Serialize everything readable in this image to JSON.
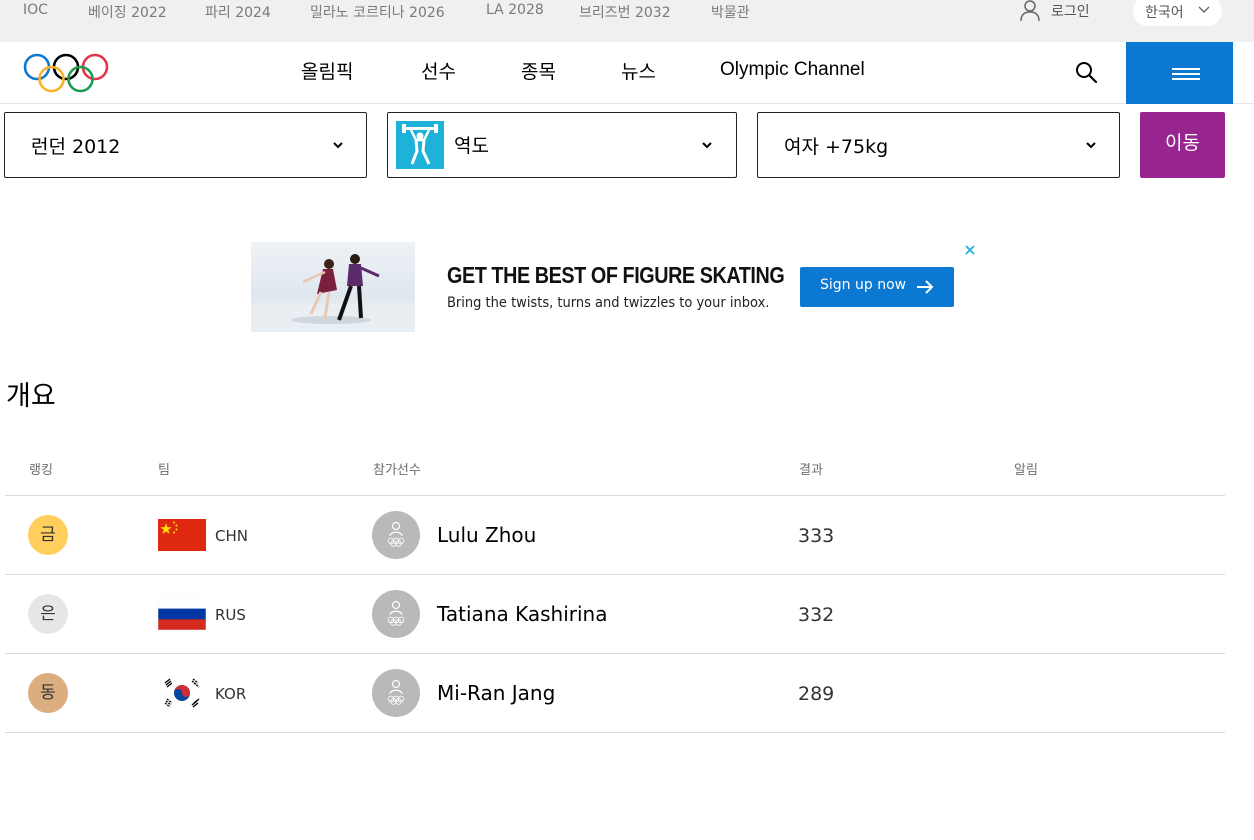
{
  "topbar": {
    "links": [
      "IOC",
      "베이징 2022",
      "파리 2024",
      "밀라노 코르티나 2026",
      "LA 2028",
      "브리즈번 2032",
      "박물관"
    ],
    "login_label": "로그인",
    "language_label": "한국어"
  },
  "nav": {
    "items": [
      "올림픽",
      "선수",
      "종목",
      "뉴스",
      "Olympic Channel"
    ]
  },
  "filters": {
    "games": "런던 2012",
    "sport": "역도",
    "event": "여자 +75kg",
    "go_label": "이동"
  },
  "ad": {
    "title": "GET THE BEST OF FIGURE SKATING",
    "subtitle": "Bring the twists, turns and twizzles to your inbox.",
    "button_label": "Sign up now"
  },
  "section": {
    "title": "개요"
  },
  "table": {
    "headers": [
      "랭킹",
      "팀",
      "참가선수",
      "결과",
      "알림"
    ],
    "rows": [
      {
        "medal": "금",
        "medal_color": "#ffce5c",
        "noc": "CHN",
        "athlete": "Lulu Zhou",
        "result": "333"
      },
      {
        "medal": "은",
        "medal_color": "#e6e6e6",
        "noc": "RUS",
        "athlete": "Tatiana Kashirina",
        "result": "332"
      },
      {
        "medal": "동",
        "medal_color": "#dcae7f",
        "noc": "KOR",
        "athlete": "Mi-Ran Jang",
        "result": "289"
      }
    ]
  },
  "colors": {
    "accent_blue": "#0b78d1",
    "go_purple": "#98258f",
    "sport_icon": "#1fb2d8"
  }
}
